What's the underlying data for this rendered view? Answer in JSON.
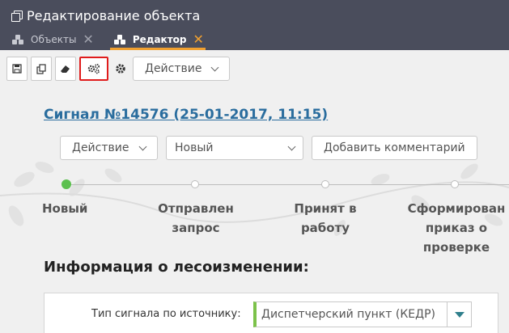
{
  "window": {
    "title": "Редактирование объекта"
  },
  "tabs": [
    {
      "label": "Объекты",
      "active": false,
      "icon": "cubes-icon"
    },
    {
      "label": "Редактор",
      "active": true,
      "icon": "cubes-icon"
    }
  ],
  "toolbar": {
    "buttons": [
      {
        "icon": "save-icon"
      },
      {
        "icon": "copy-icon"
      },
      {
        "icon": "eraser-icon"
      },
      {
        "icon": "settings-cogs-icon",
        "highlighted": true
      },
      {
        "icon": "gear-icon"
      }
    ],
    "action_dropdown_label": "Действие"
  },
  "signal": {
    "link_text": "Сигнал №14576 (25-01-2017, 11:15)"
  },
  "row_actions": {
    "action_dropdown_label": "Действие",
    "status_select_value": "Новый",
    "add_comment_label": "Добавить комментарий"
  },
  "timeline": {
    "stages": [
      {
        "lines": [
          "Новый"
        ],
        "done": true
      },
      {
        "lines": [
          "Отправлен",
          "запрос"
        ],
        "done": false
      },
      {
        "lines": [
          "Принят в",
          "работу"
        ],
        "done": false
      },
      {
        "lines": [
          "Сформирован",
          "приказ о",
          "проверке"
        ],
        "done": false
      }
    ]
  },
  "info_section": {
    "title": "Информация о лесоизменении:",
    "field_label": "Тип сигнала по источнику:",
    "field_value": "Диспетчерский пункт (КЕДР)"
  },
  "colors": {
    "titlebar": "#4a4d5c",
    "active_tab_accent": "#f0a030",
    "link": "#2a6d9e",
    "status_done": "#5cc04f",
    "highlight_border": "#e01b1b",
    "field_accent": "#7cc24a"
  }
}
